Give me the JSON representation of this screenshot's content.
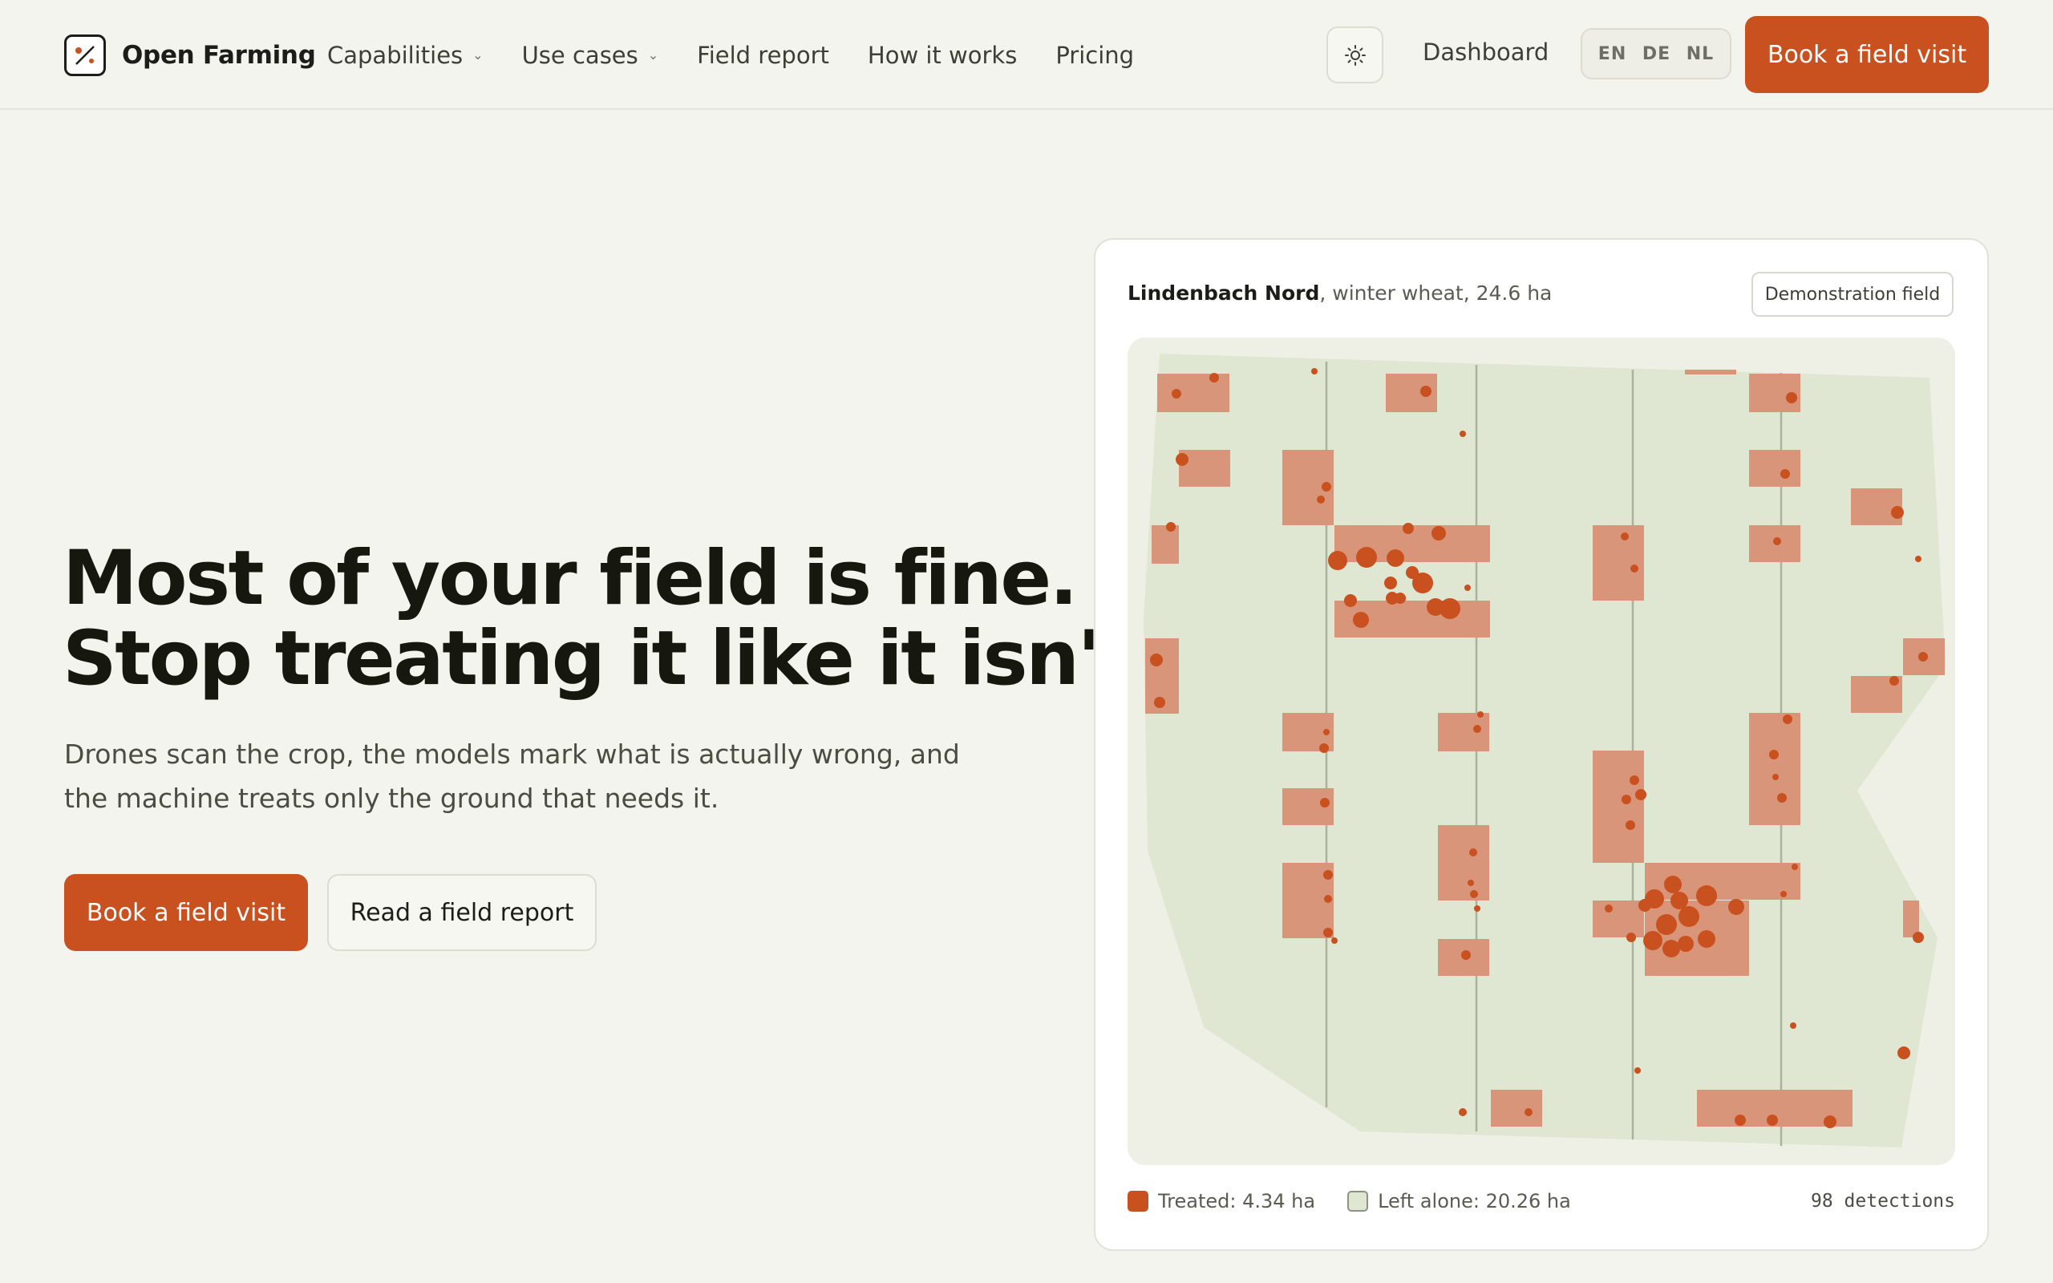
{
  "brand": {
    "name": "Open Farming"
  },
  "nav": {
    "items": [
      {
        "label": "Capabilities",
        "dropdown": true
      },
      {
        "label": "Use cases",
        "dropdown": true
      },
      {
        "label": "Field report",
        "dropdown": false
      },
      {
        "label": "How it works",
        "dropdown": false
      },
      {
        "label": "Pricing",
        "dropdown": false
      }
    ],
    "dashboard": "Dashboard",
    "languages": [
      "EN",
      "DE",
      "NL"
    ],
    "cta": "Book a field visit"
  },
  "hero": {
    "title_line1": "Most of your field is fine.",
    "title_line2": "Stop treating it like it isn't.",
    "subtitle": "Drones scan the crop, the models mark what is actually wrong, and the machine treats only the ground that needs it.",
    "primary_button": "Book a field visit",
    "secondary_button": "Read a field report"
  },
  "field_card": {
    "field_name": "Lindenbach Nord",
    "field_meta": ", winter wheat, 24.6 ha",
    "badge": "Demonstration field",
    "legend_treated": "Treated: 4.34 ha",
    "legend_left_alone": "Left alone: 20.26 ha",
    "detections": "98 detections"
  },
  "colors": {
    "accent": "#c9501f",
    "treated_fill": "#d9957a",
    "field_fill": "#dfe6d2",
    "background": "#f4f4ee"
  },
  "icons": {
    "theme_toggle": "sun-icon",
    "logo": "logo-mark-icon"
  }
}
